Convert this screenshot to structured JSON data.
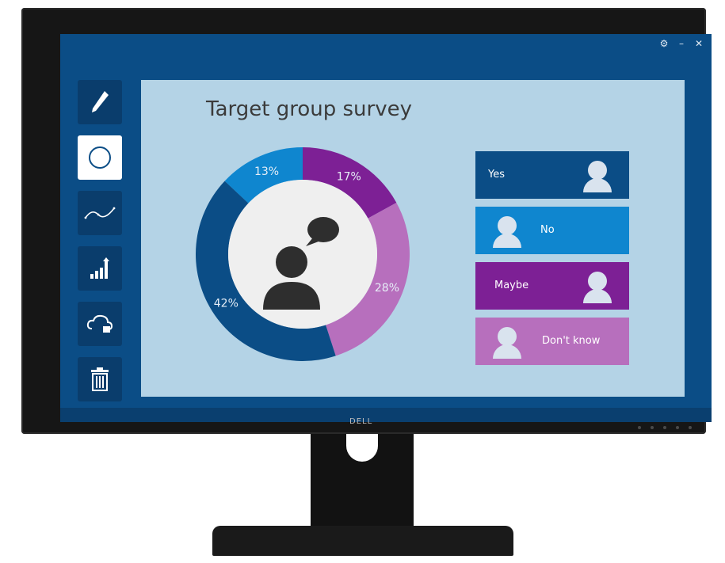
{
  "window": {
    "controls": {
      "gear": "⚙",
      "minimize": "–",
      "close": "✕"
    }
  },
  "toolbar": {
    "tools": [
      {
        "name": "pen-tool",
        "icon": "pen-icon"
      },
      {
        "name": "circle-tool",
        "icon": "circle-icon",
        "active": true
      },
      {
        "name": "line-tool",
        "icon": "trend-line-icon"
      },
      {
        "name": "bar-tool",
        "icon": "bar-growth-icon"
      },
      {
        "name": "cloud-tool",
        "icon": "cloud-lock-icon"
      },
      {
        "name": "delete-tool",
        "icon": "trash-icon"
      }
    ]
  },
  "main": {
    "title": "Target group survey"
  },
  "chart_data": {
    "type": "pie",
    "title": "Target group survey",
    "slices": [
      {
        "label": "Yes",
        "value": 42,
        "display": "42%",
        "color": "#0b4d86"
      },
      {
        "label": "No",
        "value": 13,
        "display": "13%",
        "color": "#0f86cf"
      },
      {
        "label": "Maybe",
        "value": 17,
        "display": "17%",
        "color": "#7d2095"
      },
      {
        "label": "Don't know",
        "value": 28,
        "display": "28%",
        "color": "#b76fbd"
      }
    ]
  },
  "legend": {
    "items": [
      {
        "label": "Yes",
        "color": "#0b4d86"
      },
      {
        "label": "No",
        "color": "#0f86cf"
      },
      {
        "label": "Maybe",
        "color": "#7d2095"
      },
      {
        "label": "Don't know",
        "color": "#b76fbd"
      }
    ]
  },
  "monitor": {
    "brand": "DELL"
  }
}
